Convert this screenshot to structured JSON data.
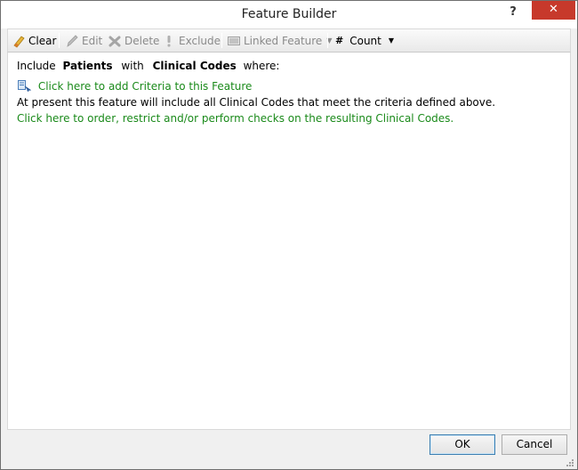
{
  "window": {
    "title": "Feature Builder",
    "help_glyph": "?",
    "close_glyph": "✕"
  },
  "toolbar": {
    "clear_label": "Clear",
    "edit_label": "Edit",
    "delete_label": "Delete",
    "exclude_label": "Exclude",
    "linked_feature_label": "Linked Feature",
    "count_glyph": "#",
    "count_label": "Count"
  },
  "content": {
    "line1": {
      "prefix": "Include",
      "entity": "Patients",
      "mid": "with",
      "codes": "Clinical Codes",
      "suffix": "where:"
    },
    "add_criteria_link": "Click here to add Criteria to this Feature",
    "present_text": "At present this feature will include all Clinical Codes that meet the criteria defined above.",
    "order_link": "Click here to order, restrict and/or perform checks on the resulting Clinical Codes."
  },
  "footer": {
    "ok_label": "OK",
    "cancel_label": "Cancel"
  },
  "colors": {
    "link": "#1a8a1a",
    "close": "#c7392b"
  }
}
